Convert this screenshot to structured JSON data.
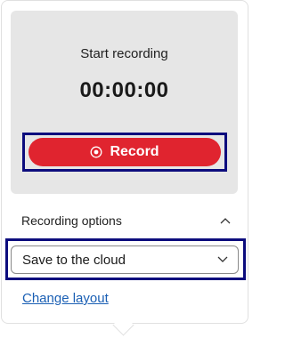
{
  "recording": {
    "status": "Start recording",
    "timer": "00:00:00",
    "record_label": "Record",
    "record_icon": "record-icon",
    "accent_color": "#e0242f"
  },
  "options": {
    "header_label": "Recording options",
    "header_icon": "chevron-up-icon",
    "save_location": {
      "value": "Save to the cloud",
      "icon": "chevron-down-icon"
    },
    "change_layout_label": "Change layout"
  }
}
